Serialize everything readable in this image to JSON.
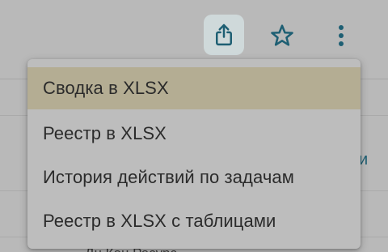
{
  "toolbar": {
    "export_icon": "share-upload-icon",
    "favorite_icon": "star-outline-icon",
    "more_icon": "more-vertical-icon",
    "accent_color": "#1e5f73",
    "export_active_bg": "#cfd9da"
  },
  "export_menu": {
    "items": [
      {
        "label": "Сводка в XLSX",
        "highlighted": true
      },
      {
        "label": "Реестр в XLSX",
        "highlighted": false
      },
      {
        "label": "История действий по задачам",
        "highlighted": false
      },
      {
        "label": "Реестр в XLSX с таблицами",
        "highlighted": false
      }
    ],
    "highlight_color": "#b4ad93"
  },
  "background": {
    "partial_link": "и",
    "partial_row_text": "Дн Кон Ресурс"
  }
}
